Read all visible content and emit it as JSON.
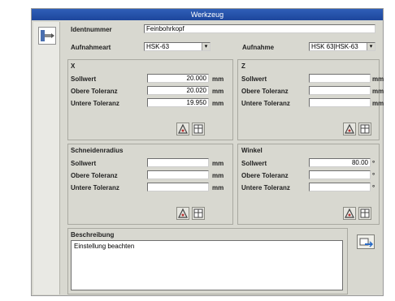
{
  "window": {
    "title": "Werkzeug"
  },
  "header": {
    "ident_label": "Identnummer",
    "ident_value": "Feinbohrkopf",
    "aufnahmeart_label": "Aufnahmeart",
    "aufnahmeart_value": "HSK-63",
    "aufnahme_label": "Aufnahme",
    "aufnahme_value": "HSK 63|HSK-63"
  },
  "x_group": {
    "title": "X",
    "rows": [
      {
        "label": "Sollwert",
        "value": "20.000",
        "unit": "mm"
      },
      {
        "label": "Obere Toleranz",
        "value": "20.020",
        "unit": "mm"
      },
      {
        "label": "Untere Toleranz",
        "value": "19.950",
        "unit": "mm"
      }
    ]
  },
  "z_group": {
    "title": "Z",
    "rows": [
      {
        "label": "Sollwert",
        "value": "",
        "unit": "mm"
      },
      {
        "label": "Obere Toleranz",
        "value": "",
        "unit": "mm"
      },
      {
        "label": "Untere Toleranz",
        "value": "",
        "unit": "mm"
      }
    ]
  },
  "radius_group": {
    "title": "Schneidenradius",
    "rows": [
      {
        "label": "Sollwert",
        "value": "",
        "unit": "mm"
      },
      {
        "label": "Obere Toleranz",
        "value": "",
        "unit": "mm"
      },
      {
        "label": "Untere Toleranz",
        "value": "",
        "unit": "mm"
      }
    ]
  },
  "winkel_group": {
    "title": "Winkel",
    "rows": [
      {
        "label": "Sollwert",
        "value": "80.00",
        "unit": "°"
      },
      {
        "label": "Obere Toleranz",
        "value": "",
        "unit": "°"
      },
      {
        "label": "Untere Toleranz",
        "value": "",
        "unit": "°"
      }
    ]
  },
  "beschreibung": {
    "title": "Beschreibung",
    "text": "Einstellung beachten"
  },
  "icons": {
    "tool": "tool-holder-icon",
    "measure": "measure-icon",
    "table": "table-icon",
    "ok": "ok-icon"
  }
}
